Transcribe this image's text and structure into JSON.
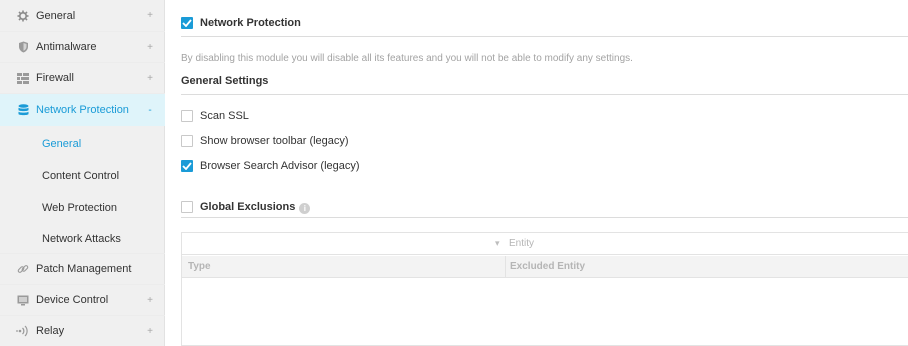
{
  "sidebar": {
    "items": [
      {
        "label": "General",
        "icon": "gear-icon",
        "expand": "+"
      },
      {
        "label": "Antimalware",
        "icon": "shield-icon",
        "expand": "+"
      },
      {
        "label": "Firewall",
        "icon": "firewall-icon",
        "expand": "+"
      },
      {
        "label": "Network Protection",
        "icon": "database-icon",
        "expand": "-"
      },
      {
        "label": "General"
      },
      {
        "label": "Content Control"
      },
      {
        "label": "Web Protection"
      },
      {
        "label": "Network Attacks"
      },
      {
        "label": "Patch Management",
        "icon": "link-icon"
      },
      {
        "label": "Device Control",
        "icon": "monitor-icon",
        "expand": "+"
      },
      {
        "label": "Relay",
        "icon": "broadcast-icon",
        "expand": "+"
      }
    ]
  },
  "main": {
    "module_title": "Network Protection",
    "module_enabled": true,
    "notice": "By disabling this module you will disable all its features and you will not be able to modify any settings.",
    "general_settings_title": "General Settings",
    "settings": [
      {
        "label": "Scan SSL",
        "checked": false
      },
      {
        "label": "Show browser toolbar (legacy)",
        "checked": false
      },
      {
        "label": "Browser Search Advisor (legacy)",
        "checked": true
      }
    ],
    "global_exclusions_title": "Global Exclusions",
    "global_exclusions_checked": false,
    "table": {
      "filter_label": "Entity",
      "filter_arrow": "▾",
      "columns": [
        "Type",
        "Excluded Entity"
      ]
    }
  },
  "colors": {
    "accent": "#1a9bd7",
    "active_bg": "#dff4fa",
    "sidebar_bg": "#f0f0f0"
  }
}
